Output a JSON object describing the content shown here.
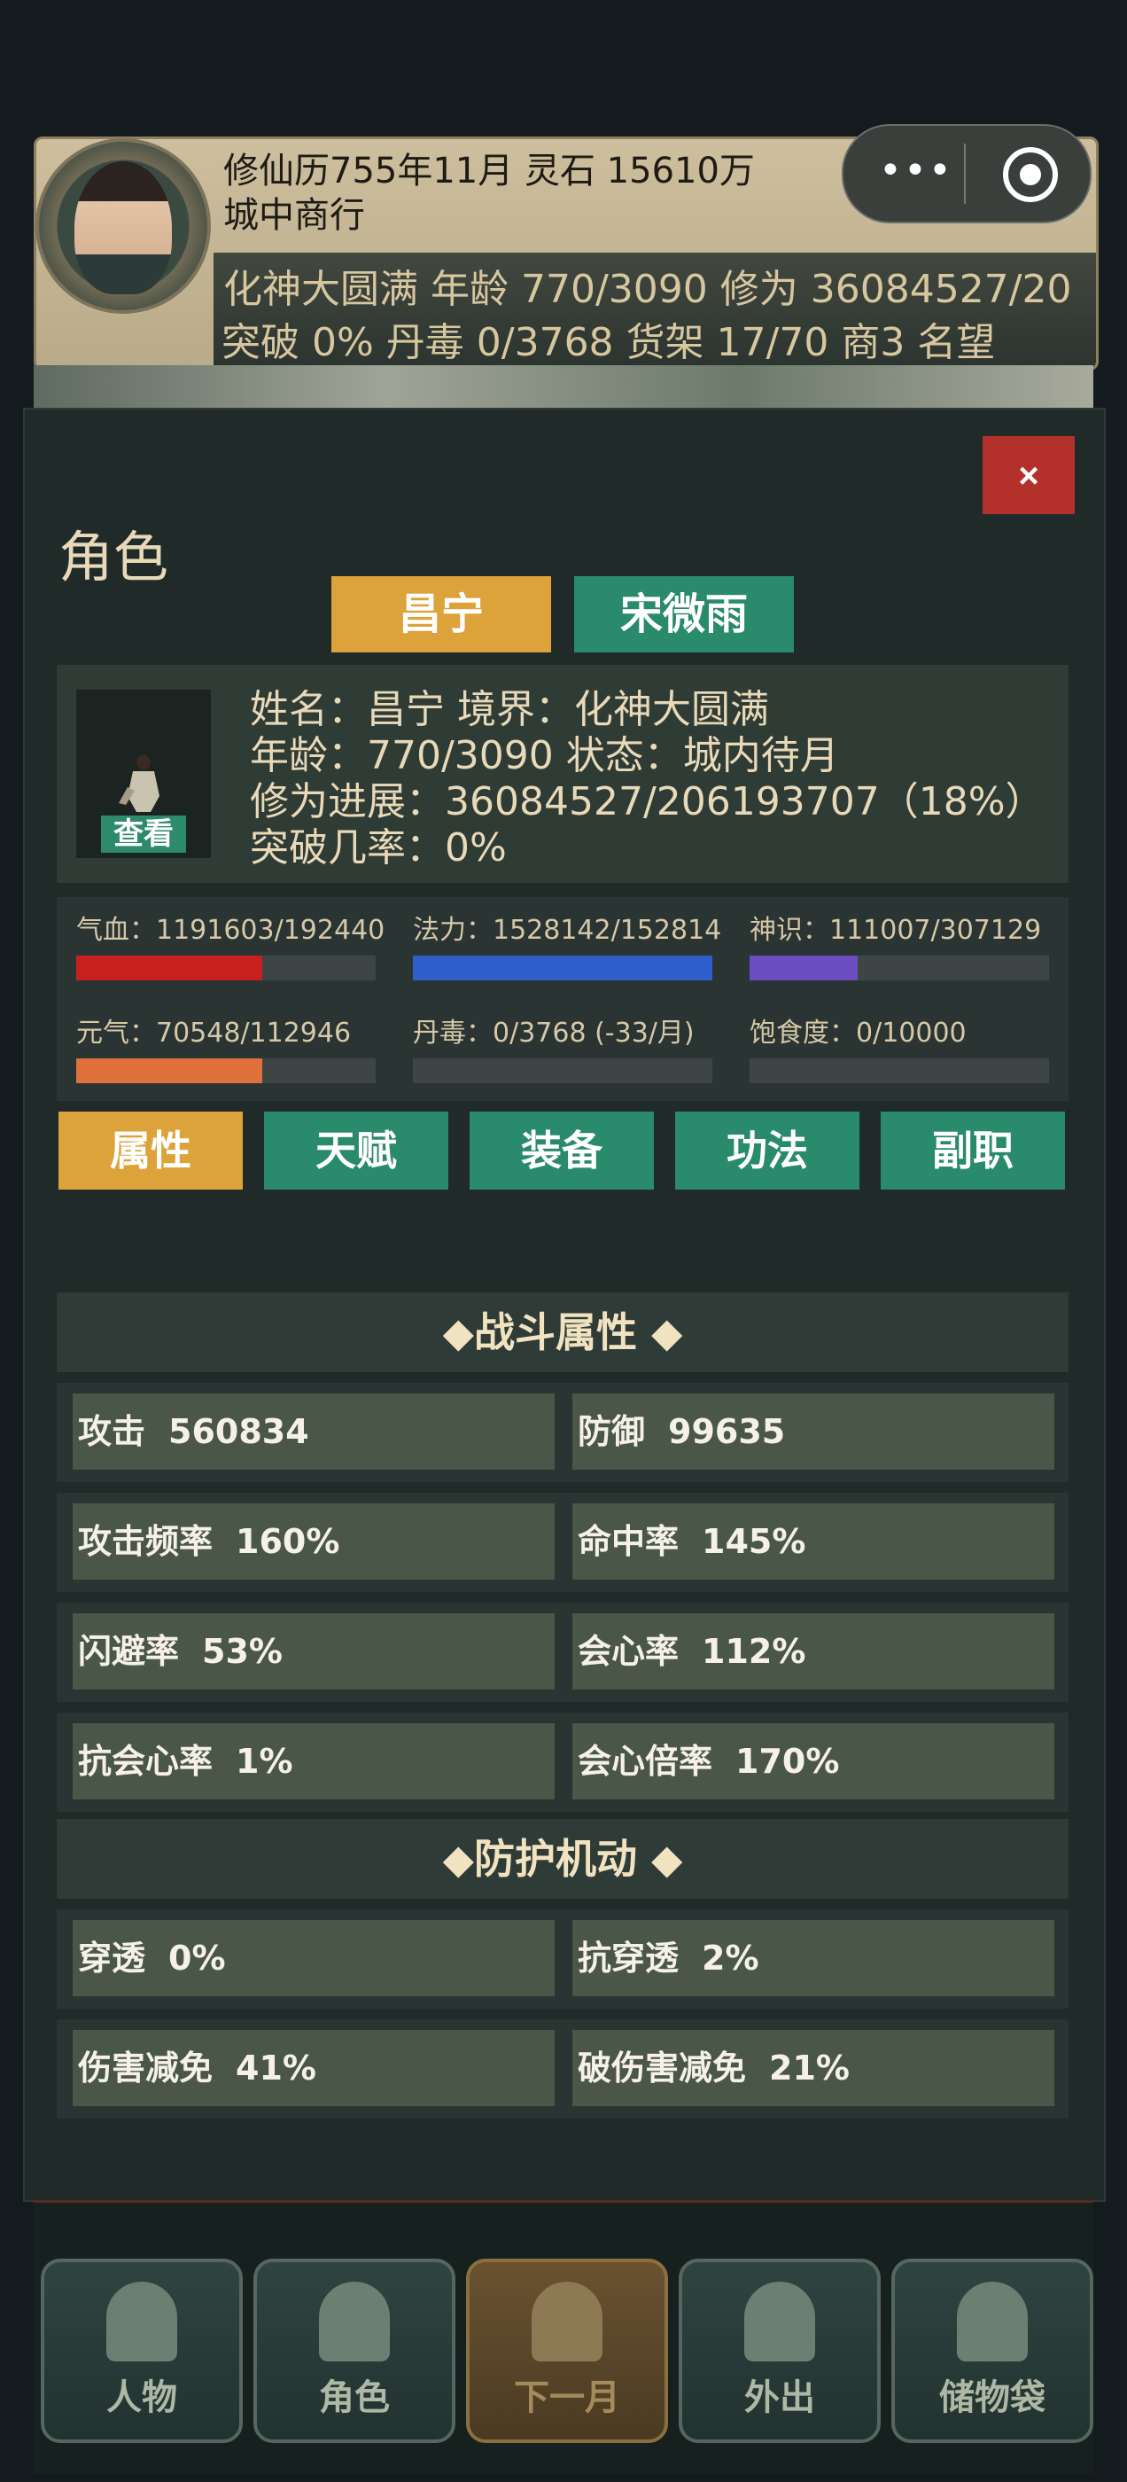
{
  "hud": {
    "line1": "修仙历755年11月    灵石 15610万",
    "line2": "城中商行",
    "line3": "化神大圆满    年龄 770/3090    修为 36084527/20",
    "line4": "突破 0%    丹毒 0/3768    货架 17/70    商3    名望"
  },
  "capsule": {
    "more": "•••"
  },
  "close_label": "×",
  "title": "角色",
  "char_tabs": [
    {
      "label": "昌宁",
      "color": "#dca33a"
    },
    {
      "label": "宋微雨",
      "color": "#2a8a6c"
    }
  ],
  "profile": {
    "view_label": "查看",
    "line1": "姓名：昌宁    境界：化神大圆满",
    "line2": "年龄：770/3090    状态：城内待月",
    "line3": "修为进展：36084527/206193707（18%）",
    "line4": "突破几率：0%"
  },
  "stats": [
    {
      "label": "气血：1191603/192440",
      "fill": 0.62,
      "color": "#c8201f"
    },
    {
      "label": "法力：1528142/152814",
      "fill": 1.0,
      "color": "#2f5fcc"
    },
    {
      "label": "神识：111007/307129",
      "fill": 0.36,
      "color": "#6a4ec0"
    },
    {
      "label": "元气：70548/112946",
      "fill": 0.62,
      "color": "#e0713a"
    },
    {
      "label": "丹毒：0/3768 (-33/月)",
      "fill": 0,
      "color": "#888888"
    },
    {
      "label": "饱食度：0/10000",
      "fill": 0,
      "color": "#888888"
    }
  ],
  "sub_tabs": [
    {
      "label": "属性",
      "active": true
    },
    {
      "label": "天赋",
      "active": false
    },
    {
      "label": "装备",
      "active": false
    },
    {
      "label": "功法",
      "active": false
    },
    {
      "label": "副职",
      "active": false
    }
  ],
  "combat_title": "◆战斗属性 ◆",
  "combat": [
    [
      {
        "k": "攻击",
        "v": "560834"
      },
      {
        "k": "防御",
        "v": "99635"
      }
    ],
    [
      {
        "k": "攻击频率",
        "v": "160%"
      },
      {
        "k": "命中率",
        "v": "145%"
      }
    ],
    [
      {
        "k": "闪避率",
        "v": "53%"
      },
      {
        "k": "会心率",
        "v": "112%"
      }
    ],
    [
      {
        "k": "抗会心率",
        "v": "1%"
      },
      {
        "k": "会心倍率",
        "v": "170%"
      }
    ]
  ],
  "defense_title": "◆防护机动 ◆",
  "defense": [
    [
      {
        "k": "穿透",
        "v": "0%"
      },
      {
        "k": "抗穿透",
        "v": "2%"
      }
    ],
    [
      {
        "k": "伤害减免",
        "v": "41%"
      },
      {
        "k": "破伤害减免",
        "v": "21%"
      }
    ]
  ],
  "nav": [
    {
      "label": "人物",
      "icon": "person-icon",
      "active": false
    },
    {
      "label": "角色",
      "icon": "character-icon",
      "active": false
    },
    {
      "label": "下一月",
      "icon": "flag-icon",
      "active": true
    },
    {
      "label": "外出",
      "icon": "travel-icon",
      "active": false
    },
    {
      "label": "储物袋",
      "icon": "bag-icon",
      "active": false
    }
  ]
}
